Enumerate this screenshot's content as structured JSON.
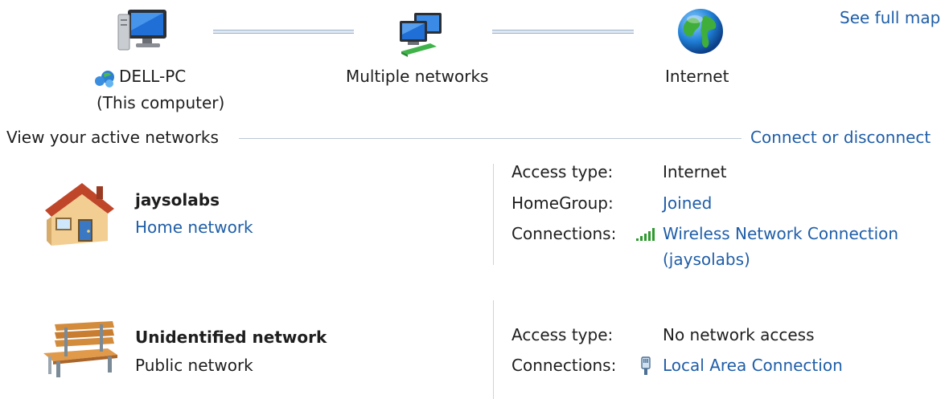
{
  "map": {
    "see_full_map": "See full map",
    "computer": {
      "name": "DELL-PC",
      "subtitle": "(This computer)"
    },
    "middle": {
      "name": "Multiple networks"
    },
    "internet": {
      "name": "Internet"
    }
  },
  "active": {
    "header": "View your active networks",
    "connect_link": "Connect or disconnect",
    "networks": [
      {
        "name": "jaysolabs",
        "type": "Home network",
        "icon": "house-icon",
        "access_label": "Access type:",
        "access_value": "Internet",
        "homegroup_label": "HomeGroup:",
        "homegroup_value": "Joined",
        "connections_label": "Connections:",
        "connection_line1": "Wireless Network Connection",
        "connection_line2": "(jaysolabs)",
        "connection_icon": "wifi-signal-icon"
      },
      {
        "name": "Unidentified network",
        "type": "Public network",
        "icon": "park-bench-icon",
        "access_label": "Access type:",
        "access_value": "No network access",
        "connections_label": "Connections:",
        "connection_line1": "Local Area Connection",
        "connection_icon": "ethernet-plug-icon"
      }
    ]
  },
  "colors": {
    "link": "#1f5ea8",
    "text": "#1e1e1e",
    "rule": "#b9c8d8"
  }
}
